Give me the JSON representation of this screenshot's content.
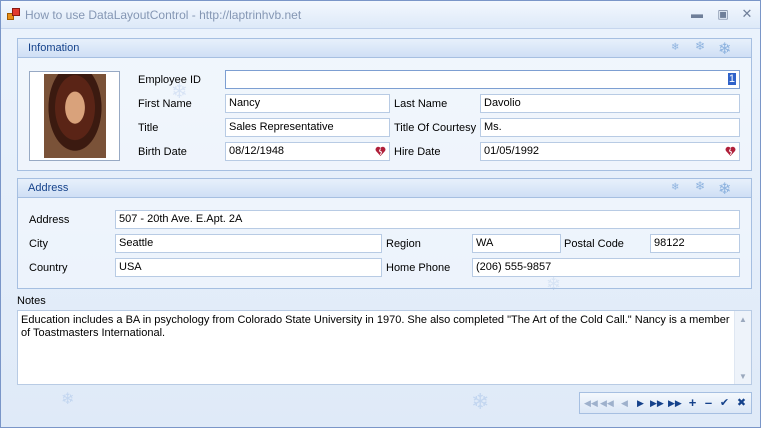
{
  "window": {
    "title": "How to use DataLayoutControl - http://laptrinhvb.net"
  },
  "info_group": {
    "header": "Infomation",
    "employee_id": {
      "label": "Employee ID",
      "value": "1"
    },
    "first_name": {
      "label": "First Name",
      "value": "Nancy"
    },
    "last_name": {
      "label": "Last Name",
      "value": "Davolio"
    },
    "title": {
      "label": "Title",
      "value": "Sales Representative"
    },
    "title_of_courtesy": {
      "label": "Title Of Courtesy",
      "value": "Ms."
    },
    "birth_date": {
      "label": "Birth Date",
      "value": "08/12/1948"
    },
    "hire_date": {
      "label": "Hire Date",
      "value": "01/05/1992"
    }
  },
  "address_group": {
    "header": "Address",
    "address": {
      "label": "Address",
      "value": "507 - 20th Ave. E.Apt. 2A"
    },
    "city": {
      "label": "City",
      "value": "Seattle"
    },
    "region": {
      "label": "Region",
      "value": "WA"
    },
    "postal_code": {
      "label": "Postal Code",
      "value": "98122"
    },
    "country": {
      "label": "Country",
      "value": "USA"
    },
    "home_phone": {
      "label": "Home Phone",
      "value": "(206) 555-9857"
    }
  },
  "notes": {
    "label": "Notes",
    "value": "Education includes a BA in psychology from Colorado State University in 1970.  She also completed \"The Art of the Cold Call.\"  Nancy is a member of Toastmasters International."
  },
  "navigator": {
    "buttons": [
      "first",
      "prev-page",
      "prev",
      "next",
      "next-page",
      "last",
      "append",
      "remove",
      "end-edit",
      "cancel-edit"
    ]
  },
  "colors": {
    "header_text": "#15428b",
    "group_border": "#a6bfe1",
    "selection": "#2f62c9",
    "date_icon": "#b0203a"
  }
}
